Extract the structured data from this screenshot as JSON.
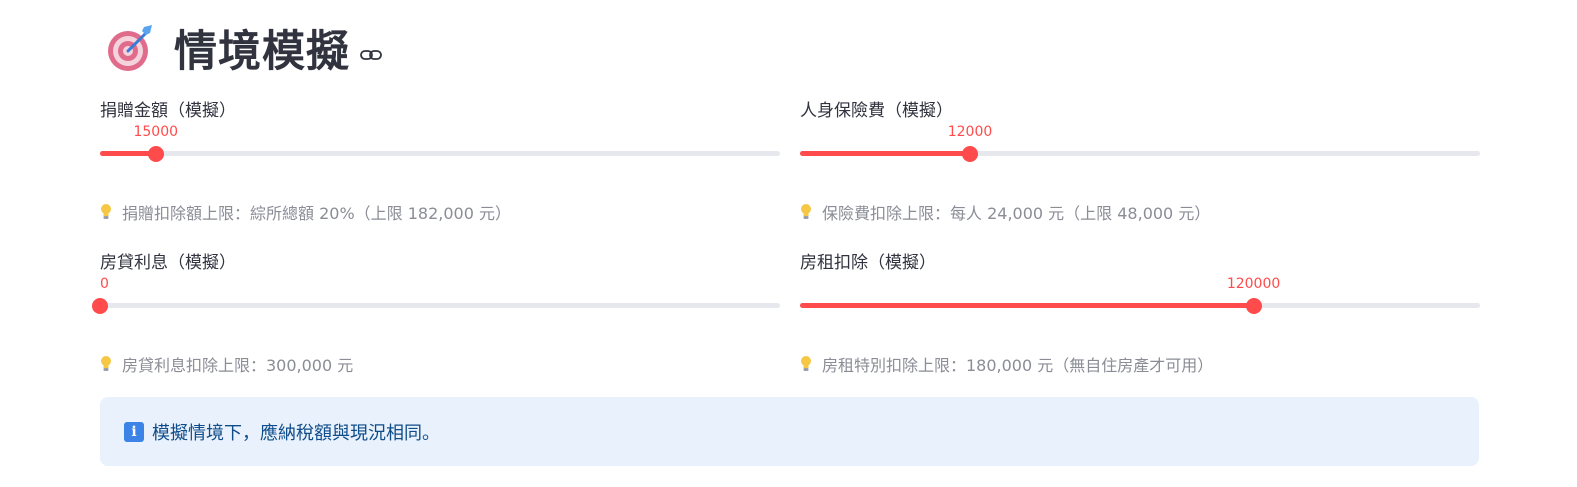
{
  "header": {
    "title": "情境模擬"
  },
  "sliders": [
    {
      "label": "捐贈金額（模擬）",
      "value": "15000",
      "fraction": 0.082,
      "hint": "捐贈扣除額上限：綜所總額 20%（上限 182,000 元）"
    },
    {
      "label": "人身保險費（模擬）",
      "value": "12000",
      "fraction": 0.25,
      "hint": "保險費扣除上限：每人 24,000 元（上限 48,000 元）"
    },
    {
      "label": "房貸利息（模擬）",
      "value": "0",
      "fraction": 0,
      "hint": "房貸利息扣除上限：300,000 元"
    },
    {
      "label": "房租扣除（模擬）",
      "value": "120000",
      "fraction": 0.667,
      "hint": "房租特別扣除上限：180,000 元（無自住房產才可用）"
    }
  ],
  "info": {
    "text": "模擬情境下，應納稅額與現況相同。"
  },
  "colors": {
    "accent": "#ff4b4b",
    "track": "#e6e8ee",
    "info_bg": "#e8f1fc",
    "info_text": "#0f4c8a"
  },
  "icons": {
    "title": "target-icon",
    "anchor": "link-icon",
    "hint": "light-bulb-icon",
    "info": "info-icon"
  }
}
